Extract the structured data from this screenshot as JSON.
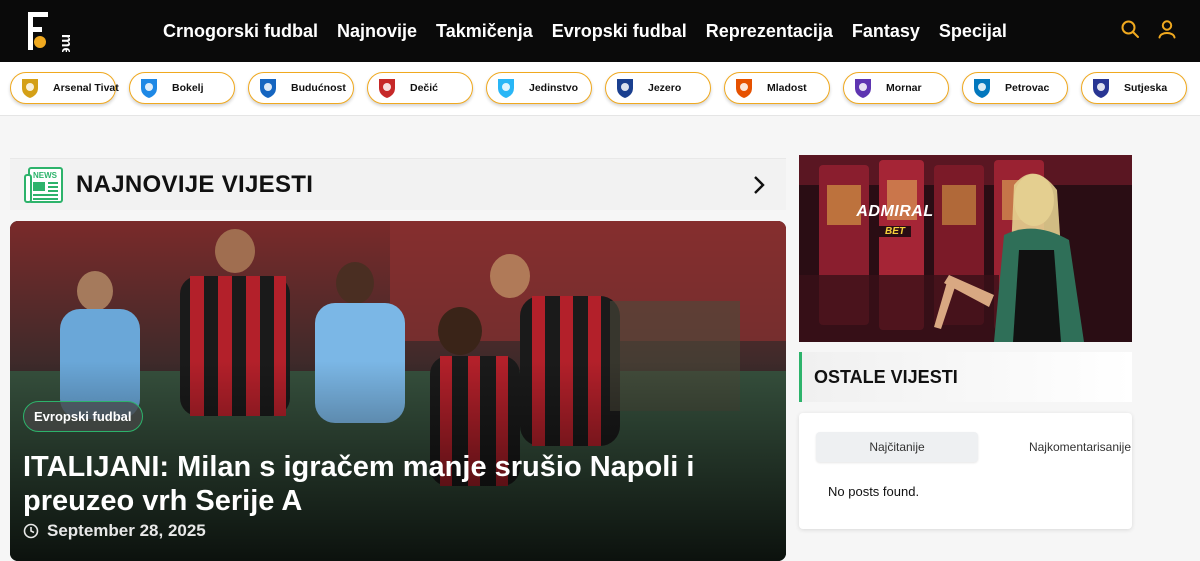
{
  "brand": {
    "logo_text": "F me",
    "accent": "#f0a91f",
    "green": "#2db36b"
  },
  "nav": {
    "items": [
      "Crnogorski fudbal",
      "Najnovije",
      "Takmičenja",
      "Evropski fudbal",
      "Reprezentacija",
      "Fantasy",
      "Specijal"
    ],
    "icons": [
      "search-icon",
      "user-icon"
    ]
  },
  "clubs": [
    {
      "name": "Arsenal Tivat",
      "color": "#d4a017"
    },
    {
      "name": "Bokelj",
      "color": "#1e88e5"
    },
    {
      "name": "Budućnost",
      "color": "#1565c0"
    },
    {
      "name": "Dečić",
      "color": "#c62828"
    },
    {
      "name": "Jedinstvo",
      "color": "#29b6f6"
    },
    {
      "name": "Jezero",
      "color": "#1a3f8f"
    },
    {
      "name": "Mladost",
      "color": "#e65100"
    },
    {
      "name": "Mornar",
      "color": "#5e35b1"
    },
    {
      "name": "Petrovac",
      "color": "#0277bd"
    },
    {
      "name": "Sutjeska",
      "color": "#283593"
    }
  ],
  "main": {
    "section_title": "NAJNOVIJE VIJESTI",
    "hero": {
      "category": "Evropski fudbal",
      "title": "ITALIJANI: Milan s igračem manje srušio Napoli i preuzeo vrh Serije A",
      "date": "September 28, 2025"
    }
  },
  "sidebar": {
    "ad_brand": "ADMIRAL",
    "ad_sub": "BET",
    "section_title": "OSTALE VIJESTI",
    "tabs": [
      "Najčitanije",
      "Najkomentarisanije"
    ],
    "empty_text": "No posts found."
  }
}
